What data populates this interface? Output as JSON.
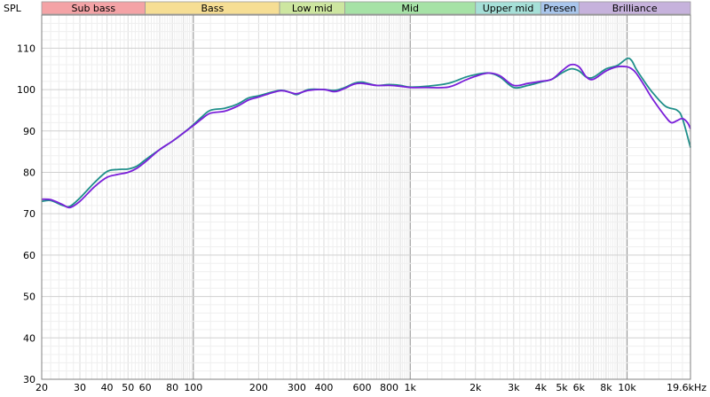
{
  "chart_data": {
    "type": "line",
    "ylabel": "SPL",
    "x_unit": "Hz",
    "x_scale": "log",
    "xlim": [
      20,
      19600
    ],
    "ylim": [
      30,
      118
    ],
    "grid": true,
    "y_ticks": [
      30,
      40,
      50,
      60,
      70,
      80,
      90,
      100,
      110
    ],
    "x_ticks": [
      {
        "v": 20,
        "label": "20"
      },
      {
        "v": 30,
        "label": "30"
      },
      {
        "v": 40,
        "label": "40"
      },
      {
        "v": 50,
        "label": "50"
      },
      {
        "v": 60,
        "label": "60"
      },
      {
        "v": 80,
        "label": "80"
      },
      {
        "v": 100,
        "label": "100"
      },
      {
        "v": 200,
        "label": "200"
      },
      {
        "v": 300,
        "label": "300"
      },
      {
        "v": 400,
        "label": "400"
      },
      {
        "v": 600,
        "label": "600"
      },
      {
        "v": 800,
        "label": "800"
      },
      {
        "v": 1000,
        "label": "1k"
      },
      {
        "v": 2000,
        "label": "2k"
      },
      {
        "v": 3000,
        "label": "3k"
      },
      {
        "v": 4000,
        "label": "4k"
      },
      {
        "v": 5000,
        "label": "5k"
      },
      {
        "v": 6000,
        "label": "6k"
      },
      {
        "v": 8000,
        "label": "8k"
      },
      {
        "v": 10000,
        "label": "10k"
      },
      {
        "v": 19600,
        "label": "19.6kHz"
      }
    ],
    "bands": [
      {
        "name": "Sub bass",
        "from": 20,
        "to": 60,
        "color": "#f4a3a6"
      },
      {
        "name": "Bass",
        "from": 60,
        "to": 250,
        "color": "#f6de94"
      },
      {
        "name": "Low mid",
        "from": 250,
        "to": 500,
        "color": "#cde6a0"
      },
      {
        "name": "Mid",
        "from": 500,
        "to": 2000,
        "color": "#a6e2a6"
      },
      {
        "name": "Upper mid",
        "from": 2000,
        "to": 4000,
        "color": "#a6e0d8"
      },
      {
        "name": "Presen",
        "from": 4000,
        "to": 6000,
        "color": "#a9c6ec"
      },
      {
        "name": "Brilliance",
        "from": 6000,
        "to": 19600,
        "color": "#c6b2dc"
      }
    ],
    "series": [
      {
        "color": "#1f8f8a",
        "points": [
          [
            20,
            73
          ],
          [
            22,
            73.2
          ],
          [
            25,
            72
          ],
          [
            27,
            71.8
          ],
          [
            30,
            73.8
          ],
          [
            35,
            77.5
          ],
          [
            40,
            80.2
          ],
          [
            45,
            80.7
          ],
          [
            50,
            80.8
          ],
          [
            55,
            81.5
          ],
          [
            60,
            83
          ],
          [
            70,
            85.5
          ],
          [
            80,
            87.5
          ],
          [
            90,
            89.5
          ],
          [
            100,
            91.5
          ],
          [
            110,
            93.5
          ],
          [
            120,
            95
          ],
          [
            140,
            95.5
          ],
          [
            160,
            96.5
          ],
          [
            180,
            98
          ],
          [
            200,
            98.5
          ],
          [
            250,
            99.8
          ],
          [
            280,
            99.3
          ],
          [
            300,
            98.8
          ],
          [
            340,
            100
          ],
          [
            400,
            100
          ],
          [
            450,
            99.8
          ],
          [
            500,
            100.5
          ],
          [
            550,
            101.5
          ],
          [
            600,
            101.8
          ],
          [
            700,
            101
          ],
          [
            800,
            101.2
          ],
          [
            900,
            101
          ],
          [
            1000,
            100.6
          ],
          [
            1200,
            100.8
          ],
          [
            1500,
            101.5
          ],
          [
            1800,
            103
          ],
          [
            2000,
            103.6
          ],
          [
            2300,
            104
          ],
          [
            2600,
            103
          ],
          [
            3000,
            100.5
          ],
          [
            3500,
            101
          ],
          [
            4000,
            101.8
          ],
          [
            4500,
            102.5
          ],
          [
            5000,
            104
          ],
          [
            5500,
            105
          ],
          [
            6000,
            104.5
          ],
          [
            6500,
            103
          ],
          [
            7000,
            103
          ],
          [
            8000,
            105
          ],
          [
            9000,
            105.8
          ],
          [
            10000,
            107.5
          ],
          [
            10500,
            107
          ],
          [
            11000,
            105
          ],
          [
            12000,
            102
          ],
          [
            13000,
            99.5
          ],
          [
            15000,
            96
          ],
          [
            17000,
            95
          ],
          [
            18000,
            93
          ],
          [
            19600,
            86
          ]
        ]
      },
      {
        "color": "#7a1fd9",
        "points": [
          [
            20,
            73.5
          ],
          [
            22,
            73.4
          ],
          [
            25,
            72.2
          ],
          [
            27,
            71.5
          ],
          [
            30,
            73
          ],
          [
            35,
            76.5
          ],
          [
            40,
            78.8
          ],
          [
            45,
            79.5
          ],
          [
            50,
            80
          ],
          [
            55,
            81
          ],
          [
            60,
            82.5
          ],
          [
            70,
            85.5
          ],
          [
            80,
            87.5
          ],
          [
            90,
            89.5
          ],
          [
            100,
            91.3
          ],
          [
            110,
            93
          ],
          [
            120,
            94.3
          ],
          [
            140,
            94.8
          ],
          [
            160,
            96
          ],
          [
            180,
            97.5
          ],
          [
            200,
            98.2
          ],
          [
            250,
            99.7
          ],
          [
            280,
            99.3
          ],
          [
            300,
            99
          ],
          [
            340,
            99.8
          ],
          [
            400,
            100
          ],
          [
            450,
            99.5
          ],
          [
            500,
            100.3
          ],
          [
            550,
            101.3
          ],
          [
            600,
            101.5
          ],
          [
            700,
            101
          ],
          [
            800,
            101
          ],
          [
            900,
            100.8
          ],
          [
            1000,
            100.5
          ],
          [
            1200,
            100.5
          ],
          [
            1500,
            100.6
          ],
          [
            1800,
            102.3
          ],
          [
            2000,
            103.2
          ],
          [
            2300,
            104
          ],
          [
            2600,
            103.3
          ],
          [
            3000,
            101
          ],
          [
            3500,
            101.5
          ],
          [
            4000,
            102
          ],
          [
            4500,
            102.5
          ],
          [
            5000,
            104.5
          ],
          [
            5500,
            106
          ],
          [
            6000,
            105.5
          ],
          [
            6500,
            103
          ],
          [
            7000,
            102.5
          ],
          [
            8000,
            104.5
          ],
          [
            9000,
            105.5
          ],
          [
            10000,
            105.5
          ],
          [
            10500,
            105
          ],
          [
            11000,
            104
          ],
          [
            12000,
            101
          ],
          [
            13000,
            98
          ],
          [
            15000,
            93.5
          ],
          [
            16000,
            92
          ],
          [
            17000,
            92.5
          ],
          [
            18000,
            93
          ],
          [
            19000,
            92
          ],
          [
            19600,
            90.5
          ]
        ]
      }
    ]
  }
}
